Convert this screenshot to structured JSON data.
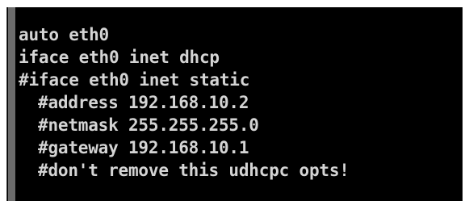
{
  "terminal": {
    "background": "#000000",
    "text_color": "#d4d4d4",
    "lines": [
      {
        "text": "auto eth0"
      },
      {
        "text": "iface eth0 inet dhcp"
      },
      {
        "text": "#iface eth0 inet static"
      },
      {
        "text": "#address 192.168.10.2"
      },
      {
        "text": "#netmask 255.255.255.0"
      },
      {
        "text": "#gateway 192.168.10.1"
      },
      {
        "text": "#don't remove this udhcpc opts!"
      }
    ]
  }
}
